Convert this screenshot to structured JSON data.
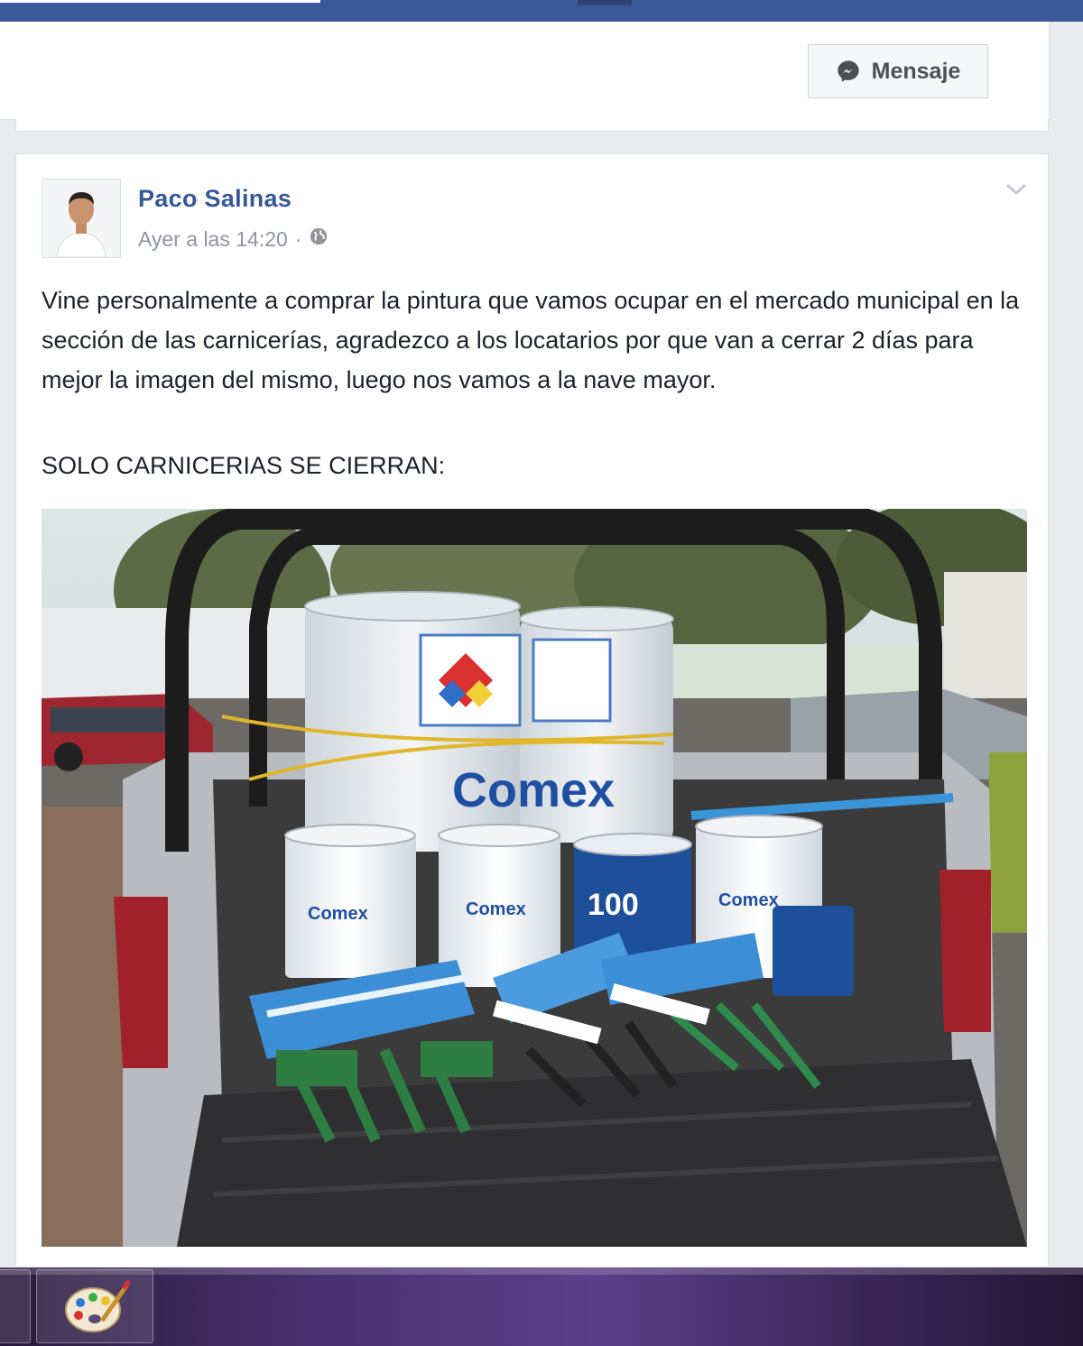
{
  "profile": {
    "message_button": "Mensaje"
  },
  "post": {
    "author": "Paco Salinas",
    "timestamp": "Ayer a las 14:20",
    "separator": "·",
    "text": "Vine personalmente a comprar la pintura que vamos ocupar en el mercado municipal en la sección de las carnicerías, agradezco a los locatarios por que van a cerrar 2 días para mejor la imagen del mismo, luego nos vamos a la nave mayor.",
    "subtext": "SOLO CARNICERIAS SE CIERRAN:",
    "photo_labels": {
      "brand": "Comex",
      "product": "100"
    }
  },
  "colors": {
    "facebook_blue": "#3b5998",
    "link": "#365899",
    "meta": "#90949c"
  },
  "icons": [
    "messenger-icon",
    "globe-icon",
    "chevron-down-icon",
    "paint-palette-icon"
  ]
}
